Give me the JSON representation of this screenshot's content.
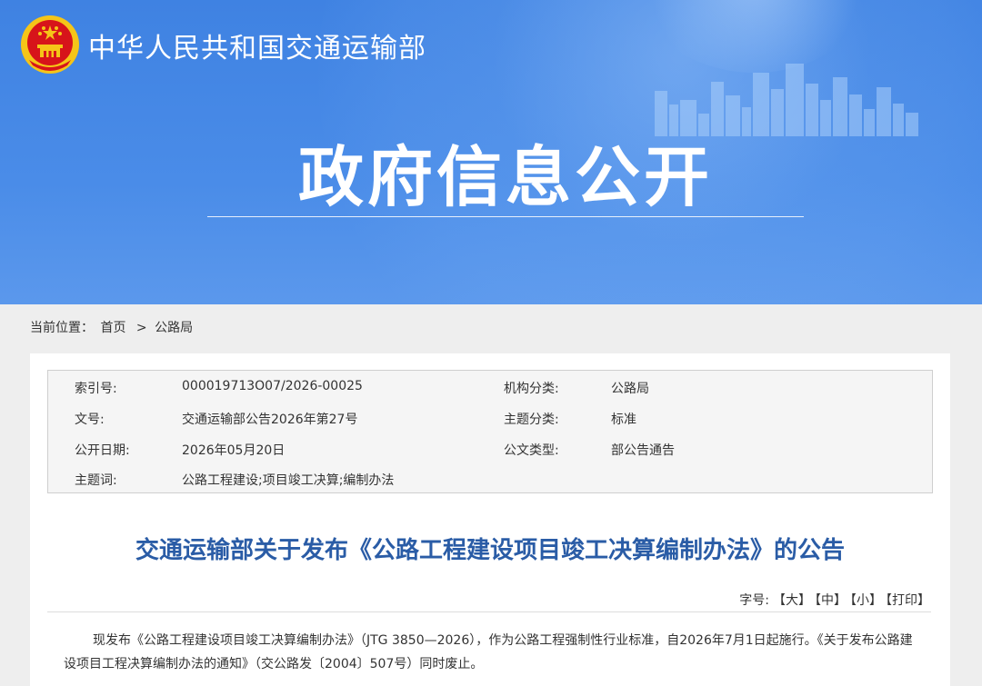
{
  "header": {
    "ministry_name": "中华人民共和国交通运输部",
    "banner_title": "政府信息公开"
  },
  "breadcrumb": {
    "prefix": "当前位置：",
    "home": "首页",
    "separator": ">",
    "current": "公路局"
  },
  "meta": {
    "rows": [
      {
        "label1": "索引号:",
        "value1": "000019713O07/2026-00025",
        "label2": "机构分类:",
        "value2": "公路局"
      },
      {
        "label1": "文号:",
        "value1": "交通运输部公告2026年第27号",
        "label2": "主题分类:",
        "value2": "标准"
      },
      {
        "label1": "公开日期:",
        "value1": "2026年05月20日",
        "label2": "公文类型:",
        "value2": "部公告通告"
      },
      {
        "label1": "主题词:",
        "value1": "公路工程建设;项目竣工决算;编制办法"
      }
    ]
  },
  "article": {
    "title": "交通运输部关于发布《公路工程建设项目竣工决算编制办法》的公告",
    "font_size_label": "字号:",
    "font_large": "【大】",
    "font_medium": "【中】",
    "font_small": "【小】",
    "print": "【打印】",
    "body": "现发布《公路工程建设项目竣工决算编制办法》（JTG 3850—2026），作为公路工程强制性行业标准，自2026年7月1日起施行。《关于发布公路建设项目工程决算编制办法的通知》（交公路发〔2004〕507号）同时废止。"
  },
  "colors": {
    "banner_blue": "#4a8ce8",
    "title_blue": "#2a5ca6",
    "emblem_red": "#d7141a",
    "emblem_gold": "#f5c518"
  }
}
